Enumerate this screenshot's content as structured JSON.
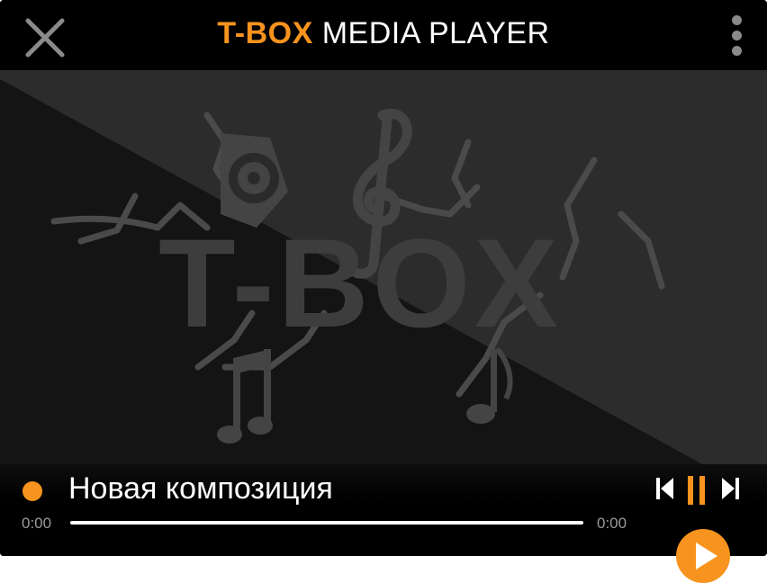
{
  "app": {
    "title_brand": "T-BOX",
    "title_rest": " MEDIA PLAYER",
    "logo_text": "T-BOX"
  },
  "icons": {
    "close": "close-icon",
    "menu": "more-vertical-icon",
    "prev": "skip-previous-icon",
    "pause": "pause-icon",
    "next": "skip-next-icon",
    "play": "play-icon",
    "speaker": "speaker-icon",
    "treble_clef": "treble-clef-icon",
    "music_note": "music-note-icon"
  },
  "track": {
    "title": "Новая композиция",
    "current_time": "0:00",
    "total_time": "0:00",
    "progress": 0
  },
  "colors": {
    "accent": "#f7931e",
    "background": "#000000",
    "text": "#ffffff",
    "muted": "#9a9a9a"
  }
}
